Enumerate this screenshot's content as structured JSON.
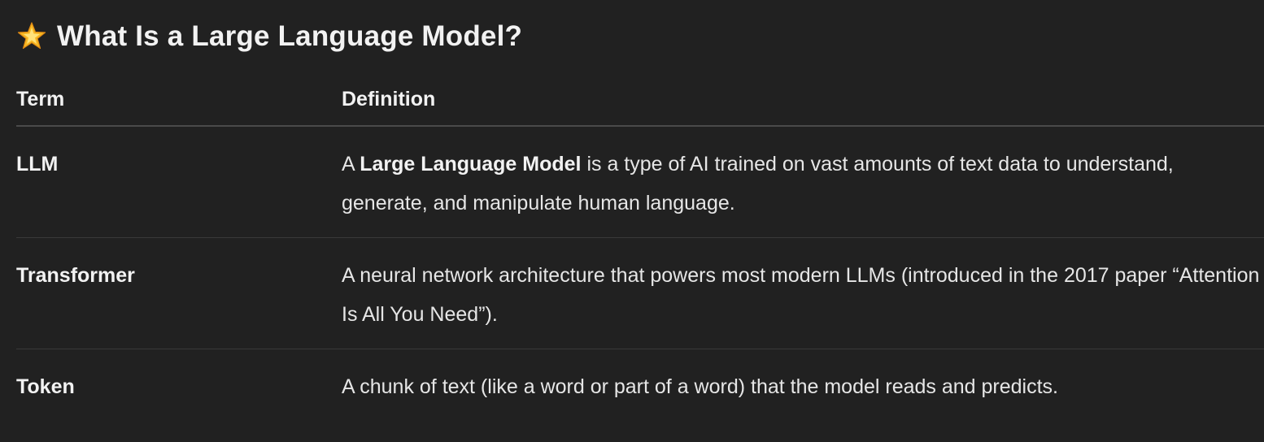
{
  "heading": {
    "icon": "glowing-star-icon",
    "title": "What Is a Large Language Model?"
  },
  "table": {
    "headers": {
      "term": "Term",
      "definition": "Definition"
    },
    "rows": [
      {
        "term": "LLM",
        "definition_prefix": "A ",
        "definition_bold": "Large Language Model",
        "definition_suffix": " is a type of AI trained on vast amounts of text data to understand, generate, and manipulate human language."
      },
      {
        "term": "Transformer",
        "definition": "A neural network architecture that powers most modern LLMs (introduced in the 2017 paper “Attention Is All You Need”)."
      },
      {
        "term": "Token",
        "definition": "A chunk of text (like a word or part of a word) that the model reads and predicts."
      }
    ]
  }
}
